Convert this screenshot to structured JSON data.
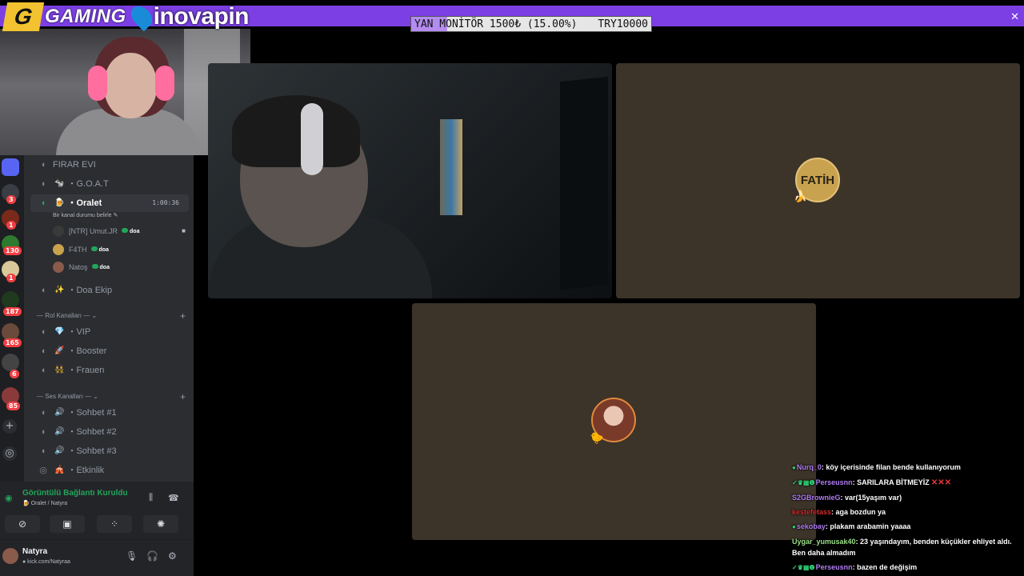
{
  "branding": {
    "gaming_badge": "G",
    "gaming_text": "GAMING",
    "sponsor_text": "inovapin"
  },
  "goal": {
    "label": "YAN MONİTÖR 1500₺ (15.00%)",
    "target": "TRY10000",
    "progress": 0.15,
    "close_label": "✕"
  },
  "discord": {
    "channels": [
      {
        "emoji": "",
        "name": "FIRAR EVI"
      },
      {
        "emoji": "🐄",
        "name": "・G.O.A.T"
      },
      {
        "emoji": "🍺",
        "name": "・Oralet",
        "timer": "1:00:36",
        "status": "Bir kanal durumu belirle ✎"
      },
      {
        "emoji": "✨",
        "name": "・Doa Ekip"
      }
    ],
    "members": [
      {
        "name": "[NTR] Umut.JR",
        "tag": "doa"
      },
      {
        "name": "F4TH",
        "tag": "doa"
      },
      {
        "name": "Natoş",
        "tag": "doa"
      }
    ],
    "categories": {
      "rol": "— Rol Kanalları — ⌄",
      "ses": "— Ses Kanalları — ⌄"
    },
    "rol_channels": [
      {
        "emoji": "💎",
        "name": "・VIP"
      },
      {
        "emoji": "🚀",
        "name": "・Booster"
      },
      {
        "emoji": "👯",
        "name": "・Frauen"
      }
    ],
    "ses_channels": [
      {
        "emoji": "🔊",
        "name": "・Sohbet #1"
      },
      {
        "emoji": "🔊",
        "name": "・Sohbet #2"
      },
      {
        "emoji": "🔊",
        "name": "・Sohbet #3"
      },
      {
        "emoji": "🎪",
        "name": "・Etkinlik"
      }
    ],
    "server_badges": [
      "3",
      "1",
      "130",
      "1",
      "187",
      "165",
      "6",
      "85"
    ],
    "voice": {
      "title": "Görüntülü Bağlantı Kuruldu",
      "subtitle": "🍺 Oralet / Natyra"
    },
    "user": {
      "name": "Natyra",
      "link": "● kick.com/Natyraa"
    }
  },
  "tiles": {
    "fatih_label": "FATİH"
  },
  "chat": [
    {
      "badges": "●",
      "user": "Nurq_0",
      "user_color": "#b07cf2",
      "text": "köy içerisinde filan bende kullanıyorum"
    },
    {
      "badges": "✓♛▦❶",
      "user": "Perseusnn",
      "user_color": "#b07cf2",
      "text": "SARILARA BİTMEYİZ",
      "suffix": "✕✕✕"
    },
    {
      "badges": "",
      "user": "S2GBrownieG",
      "user_color": "#b07cf2",
      "text": "var(15yaşım var)"
    },
    {
      "badges": "",
      "user": "kestefetass",
      "user_color": "#d22d2d",
      "text": "aga bozdun ya"
    },
    {
      "badges": "●",
      "user": "sekobay",
      "user_color": "#b07cf2",
      "text": "plakam arabamin yaaaa"
    },
    {
      "badges": "",
      "user": "Uygar_yumusak40",
      "user_color": "#9adf88",
      "text": "23 yaşındayım, benden küçükler ehliyet aldı. Ben daha almadım",
      "wrap": true
    },
    {
      "badges": "✓♛▦❶",
      "user": "Perseusnn",
      "user_color": "#b07cf2",
      "text": "bazen de değişim"
    }
  ]
}
